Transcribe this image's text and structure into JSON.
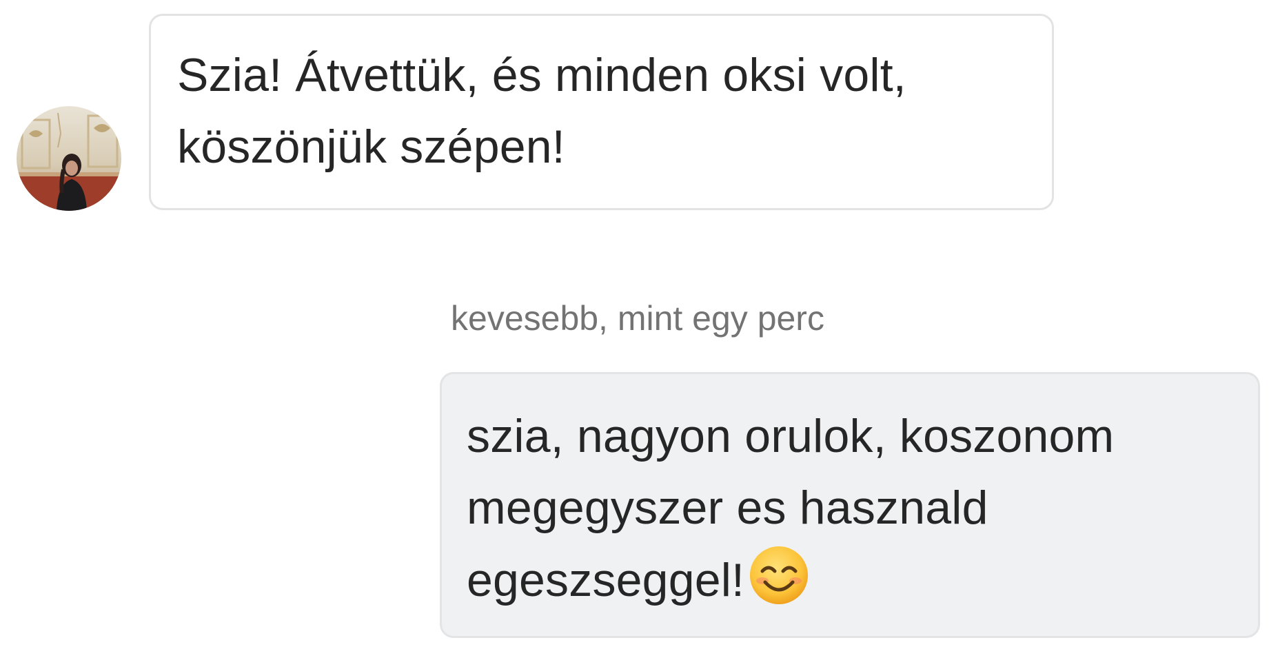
{
  "conversation": {
    "incoming": {
      "avatar_icon": "user-photo-avatar",
      "lines": [
        "Szia! Átvettük, és minden oksi volt,",
        "köszönjük szépen!"
      ]
    },
    "timestamp": "kevesebb, mint egy perc",
    "outgoing": {
      "lines": [
        "szia, nagyon orulok, koszonom",
        "megegyszer es hasznald",
        "egeszseggel!"
      ],
      "emoji_icon": "smiling-face-emoji"
    }
  },
  "colors": {
    "incoming_bubble_bg": "#ffffff",
    "incoming_bubble_border": "#e3e3e3",
    "outgoing_bubble_bg": "#eff1f2",
    "text": "#262626",
    "timestamp_text": "#737373"
  }
}
